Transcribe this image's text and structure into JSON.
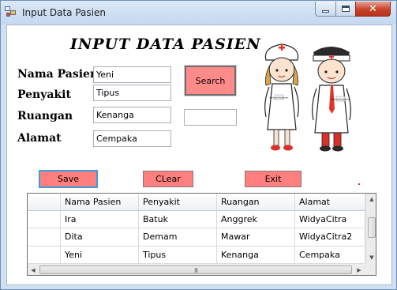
{
  "window": {
    "title": "Input Data Pasien",
    "close_glyph": "✕",
    "colors": {
      "frame": "#cfe0f3",
      "close_button": "#c7442b"
    }
  },
  "form": {
    "heading": "INPUT DATA PASIEN",
    "labels": {
      "nama": "Nama Pasien",
      "penyakit": "Penyakit",
      "ruangan": "Ruangan",
      "alamat": "Alamat"
    },
    "values": {
      "nama": "Yeni",
      "penyakit": "Tipus",
      "ruangan": "Kenanga",
      "alamat": "Cempaka"
    },
    "search_field_value": "",
    "search_label": "Search"
  },
  "actions": {
    "save": "Save",
    "clear": "CLear",
    "exit": "Exit"
  },
  "grid": {
    "columns": [
      "Nama Pasien",
      "Penyakit",
      "Ruangan",
      "Alamat"
    ],
    "rows": [
      [
        "Ira",
        "Batuk",
        "Anggrek",
        "WidyaCitra"
      ],
      [
        "Dita",
        "Demam",
        "Mawar",
        "WidyaCitra2"
      ],
      [
        "Yeni",
        "Tipus",
        "Kenanga",
        "Cempaka"
      ]
    ],
    "scroll_grip": "III"
  },
  "illustration": {
    "badge_left": "Medical Practitioner",
    "badge_right": "Medical Practitioner",
    "colors": {
      "cross": "#e0332a",
      "coat": "#ffffff"
    }
  },
  "colors": {
    "button_fill": "#ff8a8a",
    "accent_focus": "#3b9cde"
  },
  "icons": {
    "app": "form-icon",
    "minimize": "minimize-icon",
    "maximize": "maximize-icon",
    "close": "close-icon",
    "scroll_up": "arrow-up-icon",
    "scroll_down": "arrow-down-icon",
    "scroll_left": "arrow-left-icon",
    "scroll_right": "arrow-right-icon"
  }
}
